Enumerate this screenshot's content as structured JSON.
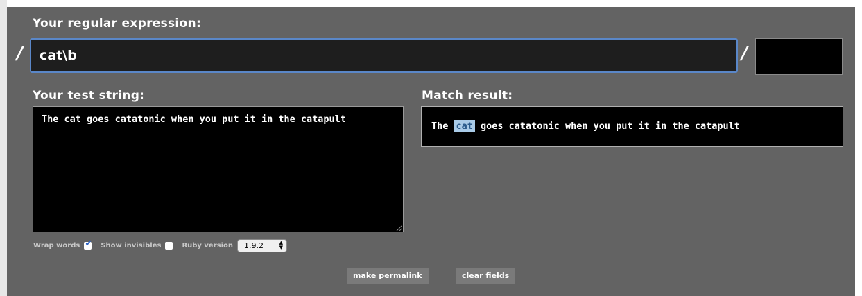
{
  "regex": {
    "label": "Your regular expression:",
    "open_delimiter": "/",
    "close_delimiter": "/",
    "value": "cat\\b",
    "flags_value": ""
  },
  "test_string": {
    "label": "Your test string:",
    "value": "The cat goes catatonic when you put it in the catapult"
  },
  "match_result": {
    "label": "Match result:",
    "before": "The ",
    "match": "cat",
    "after": " goes catatonic when you put it in the catapult"
  },
  "options": {
    "wrap_words_label": "Wrap words",
    "wrap_words_checked": true,
    "show_invisibles_label": "Show invisibles",
    "show_invisibles_checked": false,
    "ruby_version_label": "Ruby version",
    "ruby_version_selected": "1.9.2"
  },
  "buttons": {
    "permalink_label": "make permalink",
    "clear_label": "clear fields"
  },
  "colors": {
    "background": "#636363",
    "input_focus_border": "#5a87c8",
    "match_highlight": "#a9cbe8",
    "checkbox_tick": "#2a62c4"
  },
  "icons": {
    "resize_grip": "resize-grip-icon",
    "select_arrows": "updown-arrows-icon",
    "checkmark": "checkmark-icon"
  }
}
